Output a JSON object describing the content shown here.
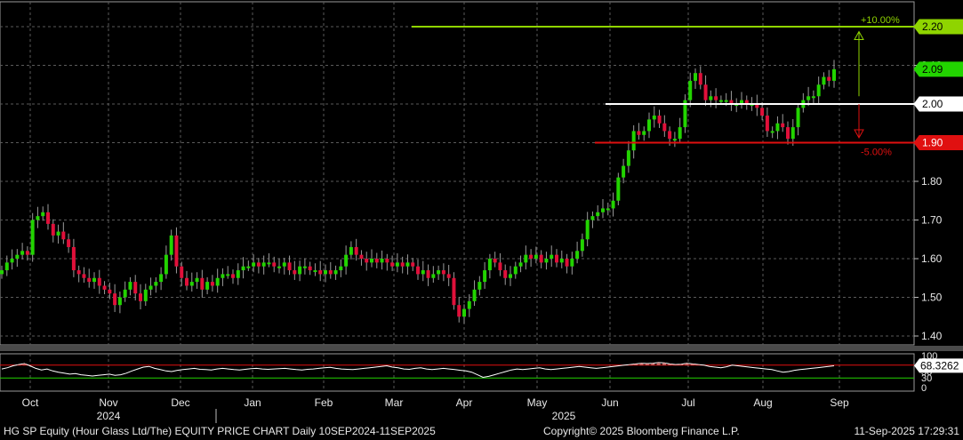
{
  "chart_data": {
    "type": "candlestick",
    "y_ticks": [
      "1.40",
      "1.50",
      "1.60",
      "1.70",
      "1.80",
      "1.90",
      "2.00",
      "2.10",
      "2.20"
    ],
    "ylim": [
      1.37,
      2.24
    ],
    "x_month_labels": [
      "Oct",
      "Nov",
      "Dec",
      "Jan",
      "Feb",
      "Mar",
      "Apr",
      "May",
      "Jun",
      "Jul",
      "Aug",
      "Sep"
    ],
    "x_year_labels": [
      "2024",
      "2025"
    ],
    "levels": [
      {
        "name": "upper",
        "value": 2.2,
        "label": "2.20",
        "pct_label": "+10.00%",
        "color": "#8fd400"
      },
      {
        "name": "current",
        "value": 2.09,
        "label": "2.09",
        "color": "#22d400"
      },
      {
        "name": "pivot",
        "value": 2.0,
        "label": "2.00",
        "color": "#000000"
      },
      {
        "name": "lower",
        "value": 1.9,
        "label": "1.90",
        "pct_label": "-5.00%",
        "color": "#e01010"
      }
    ],
    "closes": [
      1.57,
      1.59,
      1.6,
      1.61,
      1.62,
      1.61,
      1.7,
      1.71,
      1.72,
      1.69,
      1.66,
      1.67,
      1.65,
      1.63,
      1.57,
      1.56,
      1.55,
      1.54,
      1.55,
      1.53,
      1.52,
      1.51,
      1.48,
      1.5,
      1.52,
      1.54,
      1.51,
      1.49,
      1.52,
      1.53,
      1.54,
      1.56,
      1.61,
      1.66,
      1.58,
      1.55,
      1.53,
      1.54,
      1.55,
      1.52,
      1.54,
      1.53,
      1.55,
      1.56,
      1.56,
      1.55,
      1.57,
      1.58,
      1.58,
      1.59,
      1.58,
      1.59,
      1.59,
      1.58,
      1.58,
      1.59,
      1.57,
      1.56,
      1.58,
      1.58,
      1.57,
      1.57,
      1.56,
      1.57,
      1.56,
      1.57,
      1.58,
      1.61,
      1.63,
      1.61,
      1.6,
      1.59,
      1.6,
      1.59,
      1.6,
      1.59,
      1.58,
      1.59,
      1.58,
      1.59,
      1.58,
      1.56,
      1.57,
      1.55,
      1.56,
      1.57,
      1.56,
      1.55,
      1.48,
      1.45,
      1.47,
      1.49,
      1.52,
      1.54,
      1.57,
      1.6,
      1.59,
      1.57,
      1.55,
      1.56,
      1.58,
      1.59,
      1.61,
      1.6,
      1.61,
      1.59,
      1.6,
      1.61,
      1.59,
      1.6,
      1.58,
      1.6,
      1.62,
      1.65,
      1.7,
      1.71,
      1.72,
      1.73,
      1.73,
      1.75,
      1.81,
      1.84,
      1.88,
      1.93,
      1.92,
      1.93,
      1.96,
      1.97,
      1.95,
      1.93,
      1.91,
      1.91,
      1.94,
      2.01,
      2.06,
      2.08,
      2.05,
      2.01,
      2.02,
      2.01,
      2.01,
      2.01,
      2.0,
      2.0,
      2.01,
      2.0,
      2.0,
      1.99,
      1.97,
      1.93,
      1.93,
      1.95,
      1.94,
      1.91,
      1.94,
      1.99,
      2.01,
      2.02,
      2.02,
      2.05,
      2.07,
      2.06,
      2.09
    ],
    "rsi": {
      "yticks": [
        "0",
        "30",
        "50",
        "70",
        "100"
      ],
      "ylim": [
        0,
        100
      ],
      "overbought": 70,
      "oversold": 30,
      "last_label": "68.3262",
      "values": [
        58,
        62,
        68,
        72,
        75,
        68,
        60,
        55,
        58,
        52,
        48,
        45,
        42,
        44,
        40,
        38,
        36,
        38,
        40,
        42,
        38,
        40,
        45,
        52,
        58,
        64,
        66,
        60,
        56,
        52,
        50,
        54,
        56,
        58,
        60,
        57,
        56,
        55,
        58,
        60,
        58,
        56,
        55,
        57,
        59,
        60,
        58,
        57,
        58,
        59,
        60,
        58,
        56,
        55,
        57,
        58,
        60,
        62,
        63,
        60,
        58,
        57,
        56,
        58,
        60,
        62,
        64,
        66,
        68,
        64,
        62,
        58,
        57,
        60,
        62,
        58,
        56,
        58,
        60,
        58,
        56,
        54,
        52,
        48,
        40,
        32,
        35,
        40,
        45,
        50,
        55,
        58,
        56,
        58,
        60,
        62,
        58,
        56,
        58,
        60,
        62,
        64,
        66,
        64,
        62,
        60,
        62,
        64,
        66,
        68,
        70,
        72,
        74,
        76,
        75,
        76,
        78,
        77,
        74,
        72,
        73,
        76,
        74,
        72,
        70,
        66,
        64,
        62,
        65,
        70,
        68,
        66,
        64,
        62,
        60,
        58,
        56,
        52,
        48,
        50,
        54,
        56,
        58,
        60,
        62,
        64,
        66,
        68
      ]
    }
  },
  "footer": {
    "left": "HG SP Equity (Hour Glass Ltd/The) EQUITY PRICE CHART  Daily 10SEP2024-11SEP2025",
    "center": "Copyright© 2025 Bloomberg Finance L.P.",
    "right": "11-Sep-2025  17:29:31"
  }
}
